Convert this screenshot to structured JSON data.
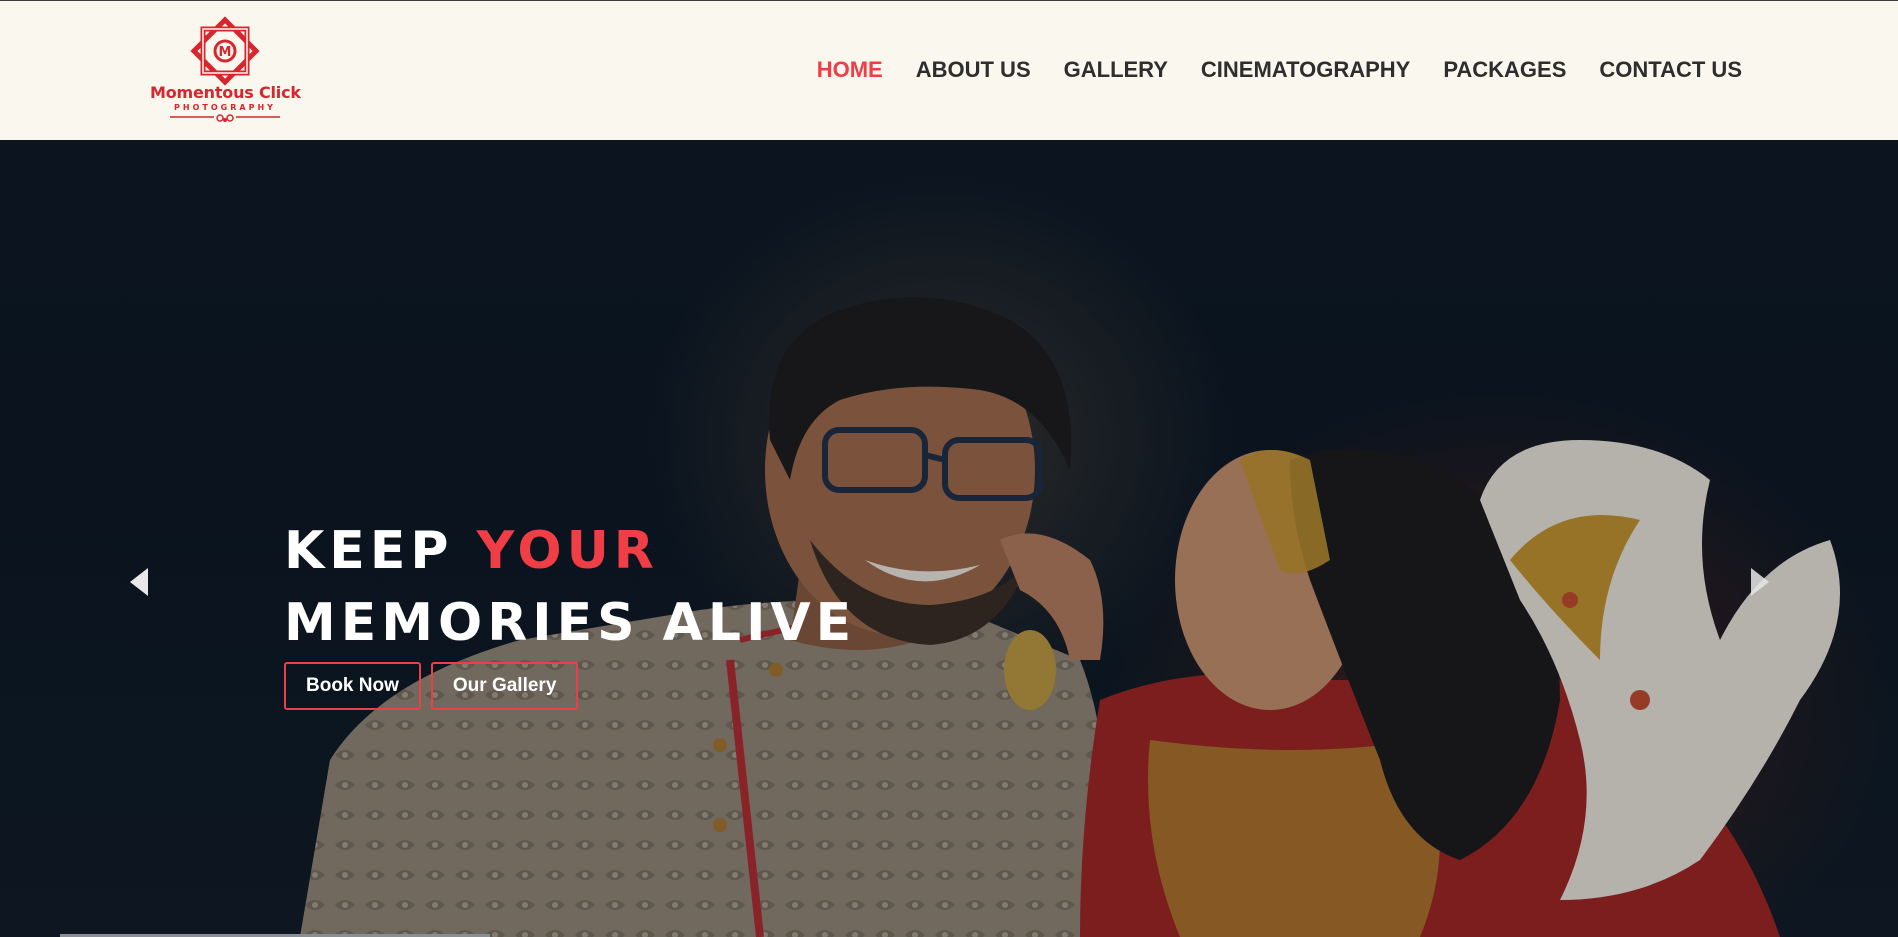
{
  "brand": {
    "name": "Momentous Click",
    "tagline": "PHOTOGRAPHY",
    "accent_color": "#ef3e46",
    "logo_color": "#d7262d"
  },
  "nav": {
    "items": [
      {
        "label": "HOME",
        "active": true
      },
      {
        "label": "ABOUT US",
        "active": false
      },
      {
        "label": "GALLERY",
        "active": false
      },
      {
        "label": "CINEMATOGRAPHY",
        "active": false
      },
      {
        "label": "PACKAGES",
        "active": false
      },
      {
        "label": "CONTACT US",
        "active": false
      }
    ]
  },
  "hero": {
    "headline_part1": "KEEP ",
    "headline_accent": "YOUR",
    "headline_line2": "MEMORIES ALIVE",
    "primary_button": "Book Now",
    "secondary_button": "Our Gallery",
    "image": "wedding couple portrait",
    "prev_icon": "triangle-left-icon",
    "next_icon": "triangle-right-icon"
  }
}
